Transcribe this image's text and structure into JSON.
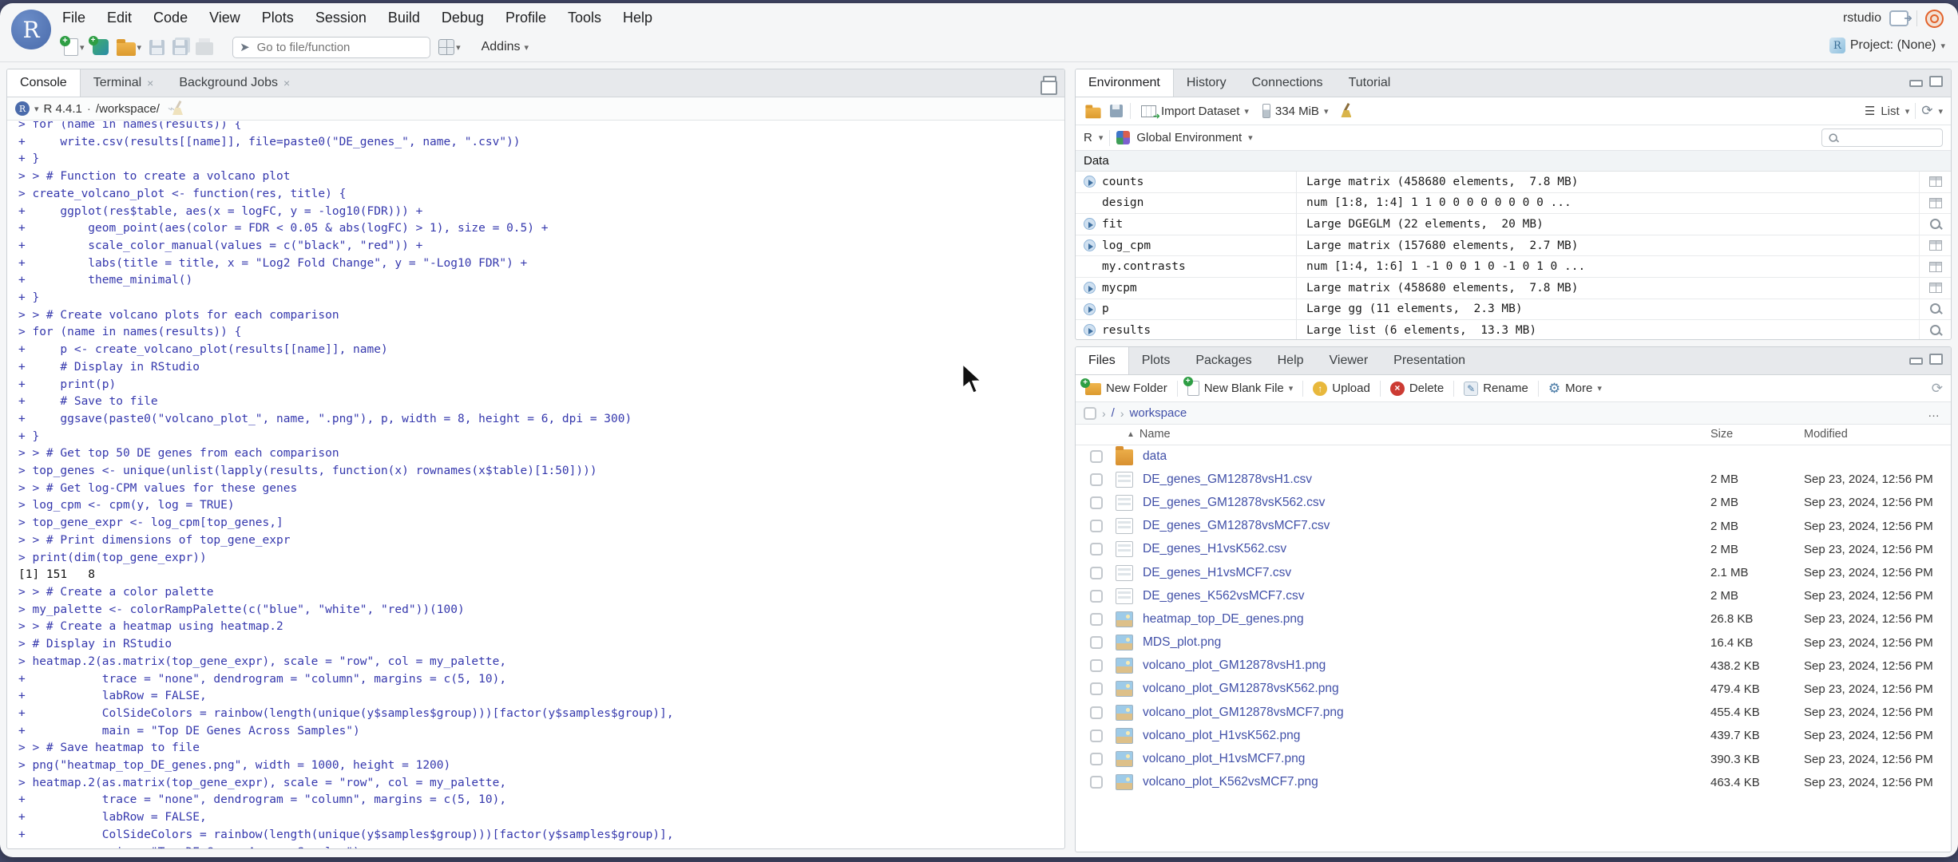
{
  "window": {
    "titlebar_user": "rstudio",
    "project_label": "Project: (None)"
  },
  "glyphs": {
    "caret_down": "▾",
    "sort_asc": "▲",
    "chevron": "›",
    "close": "×",
    "ellipsis": "…",
    "list": "☰",
    "refresh": "⟳",
    "dot_sep": "·",
    "gear": "⚙",
    "pencil": "✎",
    "up_arrow": "↑",
    "plus": "+",
    "goto_arrow": "➤"
  },
  "menu_bar": {
    "items": [
      "File",
      "Edit",
      "Code",
      "View",
      "Plots",
      "Session",
      "Build",
      "Debug",
      "Profile",
      "Tools",
      "Help"
    ]
  },
  "toolbar": {
    "goto_placeholder": "Go to file/function",
    "addins_label": "Addins"
  },
  "console_panel": {
    "tabs": [
      {
        "label": "Console",
        "active": true,
        "closable": false
      },
      {
        "label": "Terminal",
        "active": false,
        "closable": true
      },
      {
        "label": "Background Jobs",
        "active": false,
        "closable": true
      }
    ],
    "r_version": "R 4.4.1",
    "separator": "·",
    "working_directory": "/workspace/",
    "lines": [
      {
        "kind": "input",
        "text": "> for (name in names(results)) {"
      },
      {
        "kind": "input",
        "text": "+     write.csv(results[[name]], file=paste0(\"DE_genes_\", name, \".csv\"))"
      },
      {
        "kind": "input",
        "text": "+ }"
      },
      {
        "kind": "input",
        "text": "> > # Function to create a volcano plot"
      },
      {
        "kind": "input",
        "text": "> create_volcano_plot <- function(res, title) {"
      },
      {
        "kind": "input",
        "text": "+     ggplot(res$table, aes(x = logFC, y = -log10(FDR))) +"
      },
      {
        "kind": "input",
        "text": "+         geom_point(aes(color = FDR < 0.05 & abs(logFC) > 1), size = 0.5) +"
      },
      {
        "kind": "input",
        "text": "+         scale_color_manual(values = c(\"black\", \"red\")) +"
      },
      {
        "kind": "input",
        "text": "+         labs(title = title, x = \"Log2 Fold Change\", y = \"-Log10 FDR\") +"
      },
      {
        "kind": "input",
        "text": "+         theme_minimal()"
      },
      {
        "kind": "input",
        "text": "+ }"
      },
      {
        "kind": "input",
        "text": "> > # Create volcano plots for each comparison"
      },
      {
        "kind": "input",
        "text": "> for (name in names(results)) {"
      },
      {
        "kind": "input",
        "text": "+     p <- create_volcano_plot(results[[name]], name)"
      },
      {
        "kind": "input",
        "text": "+     # Display in RStudio"
      },
      {
        "kind": "input",
        "text": "+     print(p)"
      },
      {
        "kind": "input",
        "text": "+     # Save to file"
      },
      {
        "kind": "input",
        "text": "+     ggsave(paste0(\"volcano_plot_\", name, \".png\"), p, width = 8, height = 6, dpi = 300)"
      },
      {
        "kind": "input",
        "text": "+ }"
      },
      {
        "kind": "input",
        "text": "> > # Get top 50 DE genes from each comparison"
      },
      {
        "kind": "input",
        "text": "> top_genes <- unique(unlist(lapply(results, function(x) rownames(x$table)[1:50])))"
      },
      {
        "kind": "input",
        "text": "> > # Get log-CPM values for these genes"
      },
      {
        "kind": "input",
        "text": "> log_cpm <- cpm(y, log = TRUE)"
      },
      {
        "kind": "input",
        "text": "> top_gene_expr <- log_cpm[top_genes,]"
      },
      {
        "kind": "input",
        "text": "> > # Print dimensions of top_gene_expr"
      },
      {
        "kind": "input",
        "text": "> print(dim(top_gene_expr))"
      },
      {
        "kind": "output",
        "text": "[1] 151   8"
      },
      {
        "kind": "input",
        "text": "> > # Create a color palette"
      },
      {
        "kind": "input",
        "text": "> my_palette <- colorRampPalette(c(\"blue\", \"white\", \"red\"))(100)"
      },
      {
        "kind": "input",
        "text": "> > # Create a heatmap using heatmap.2"
      },
      {
        "kind": "input",
        "text": "> # Display in RStudio"
      },
      {
        "kind": "input",
        "text": "> heatmap.2(as.matrix(top_gene_expr), scale = \"row\", col = my_palette,"
      },
      {
        "kind": "input",
        "text": "+           trace = \"none\", dendrogram = \"column\", margins = c(5, 10),"
      },
      {
        "kind": "input",
        "text": "+           labRow = FALSE,"
      },
      {
        "kind": "input",
        "text": "+           ColSideColors = rainbow(length(unique(y$samples$group)))[factor(y$samples$group)],"
      },
      {
        "kind": "input",
        "text": "+           main = \"Top DE Genes Across Samples\")"
      },
      {
        "kind": "input",
        "text": "> > # Save heatmap to file"
      },
      {
        "kind": "input",
        "text": "> png(\"heatmap_top_DE_genes.png\", width = 1000, height = 1200)"
      },
      {
        "kind": "input",
        "text": "> heatmap.2(as.matrix(top_gene_expr), scale = \"row\", col = my_palette,"
      },
      {
        "kind": "input",
        "text": "+           trace = \"none\", dendrogram = \"column\", margins = c(5, 10),"
      },
      {
        "kind": "input",
        "text": "+           labRow = FALSE,"
      },
      {
        "kind": "input",
        "text": "+           ColSideColors = rainbow(length(unique(y$samples$group)))[factor(y$samples$group)],"
      },
      {
        "kind": "input",
        "text": "+           main = \"Top DE Genes Across Samples\")"
      }
    ]
  },
  "environment_panel": {
    "tabs": [
      {
        "label": "Environment",
        "active": true,
        "closable": false
      },
      {
        "label": "History",
        "active": false,
        "closable": false
      },
      {
        "label": "Connections",
        "active": false,
        "closable": false
      },
      {
        "label": "Tutorial",
        "active": false,
        "closable": false
      }
    ],
    "import_label": "Import Dataset",
    "memory_label": "334 MiB",
    "list_label": "List",
    "r_label": "R",
    "global_env_label": "Global Environment",
    "section_label": "Data",
    "rows": [
      {
        "name": "counts",
        "value": "Large matrix (458680 elements,  7.8 MB)",
        "expandable": true,
        "action": "grid"
      },
      {
        "name": "design",
        "value": "num [1:8, 1:4] 1 1 0 0 0 0 0 0 0 0 ...",
        "expandable": false,
        "action": "grid"
      },
      {
        "name": "fit",
        "value": "Large DGEGLM (22 elements,  20 MB)",
        "expandable": true,
        "action": "search"
      },
      {
        "name": "log_cpm",
        "value": "Large matrix (157680 elements,  2.7 MB)",
        "expandable": true,
        "action": "grid"
      },
      {
        "name": "my.contrasts",
        "value": "num [1:4, 1:6] 1 -1 0 0 1 0 -1 0 1 0 ...",
        "expandable": false,
        "action": "grid"
      },
      {
        "name": "mycpm",
        "value": "Large matrix (458680 elements,  7.8 MB)",
        "expandable": true,
        "action": "grid"
      },
      {
        "name": "p",
        "value": "Large gg (11 elements,  2.3 MB)",
        "expandable": true,
        "action": "search"
      },
      {
        "name": "results",
        "value": "Large list (6 elements,  13.3 MB)",
        "expandable": true,
        "action": "search"
      }
    ]
  },
  "files_panel": {
    "tabs": [
      {
        "label": "Files",
        "active": true,
        "closable": false
      },
      {
        "label": "Plots",
        "active": false,
        "closable": false
      },
      {
        "label": "Packages",
        "active": false,
        "closable": false
      },
      {
        "label": "Help",
        "active": false,
        "closable": false
      },
      {
        "label": "Viewer",
        "active": false,
        "closable": false
      },
      {
        "label": "Presentation",
        "active": false,
        "closable": false
      }
    ],
    "toolbar": [
      {
        "label": "New Folder",
        "icon": "new-folder",
        "caret": false
      },
      {
        "label": "New Blank File",
        "icon": "new-blank-file",
        "caret": true
      },
      {
        "label": "Upload",
        "icon": "upload",
        "caret": false
      },
      {
        "label": "Delete",
        "icon": "delete",
        "caret": false
      },
      {
        "label": "Rename",
        "icon": "rename",
        "caret": false
      },
      {
        "label": "More",
        "icon": "more",
        "caret": true
      }
    ],
    "breadcrumb": {
      "root": "/",
      "folder": "workspace"
    },
    "columns": [
      "Name",
      "Size",
      "Modified"
    ],
    "rows": [
      {
        "name": "data",
        "type": "folder",
        "size": "",
        "modified": ""
      },
      {
        "name": "DE_genes_GM12878vsH1.csv",
        "type": "csv",
        "size": "2 MB",
        "modified": "Sep 23, 2024, 12:56 PM"
      },
      {
        "name": "DE_genes_GM12878vsK562.csv",
        "type": "csv",
        "size": "2 MB",
        "modified": "Sep 23, 2024, 12:56 PM"
      },
      {
        "name": "DE_genes_GM12878vsMCF7.csv",
        "type": "csv",
        "size": "2 MB",
        "modified": "Sep 23, 2024, 12:56 PM"
      },
      {
        "name": "DE_genes_H1vsK562.csv",
        "type": "csv",
        "size": "2 MB",
        "modified": "Sep 23, 2024, 12:56 PM"
      },
      {
        "name": "DE_genes_H1vsMCF7.csv",
        "type": "csv",
        "size": "2.1 MB",
        "modified": "Sep 23, 2024, 12:56 PM"
      },
      {
        "name": "DE_genes_K562vsMCF7.csv",
        "type": "csv",
        "size": "2 MB",
        "modified": "Sep 23, 2024, 12:56 PM"
      },
      {
        "name": "heatmap_top_DE_genes.png",
        "type": "png",
        "size": "26.8 KB",
        "modified": "Sep 23, 2024, 12:56 PM"
      },
      {
        "name": "MDS_plot.png",
        "type": "png",
        "size": "16.4 KB",
        "modified": "Sep 23, 2024, 12:56 PM"
      },
      {
        "name": "volcano_plot_GM12878vsH1.png",
        "type": "png",
        "size": "438.2 KB",
        "modified": "Sep 23, 2024, 12:56 PM"
      },
      {
        "name": "volcano_plot_GM12878vsK562.png",
        "type": "png",
        "size": "479.4 KB",
        "modified": "Sep 23, 2024, 12:56 PM"
      },
      {
        "name": "volcano_plot_GM12878vsMCF7.png",
        "type": "png",
        "size": "455.4 KB",
        "modified": "Sep 23, 2024, 12:56 PM"
      },
      {
        "name": "volcano_plot_H1vsK562.png",
        "type": "png",
        "size": "439.7 KB",
        "modified": "Sep 23, 2024, 12:56 PM"
      },
      {
        "name": "volcano_plot_H1vsMCF7.png",
        "type": "png",
        "size": "390.3 KB",
        "modified": "Sep 23, 2024, 12:56 PM"
      },
      {
        "name": "volcano_plot_K562vsMCF7.png",
        "type": "png",
        "size": "463.4 KB",
        "modified": "Sep 23, 2024, 12:56 PM"
      }
    ]
  },
  "colors": {
    "desktop": "#434868",
    "chrome": "#f5f6f7",
    "tabbar": "#e7e9ec",
    "console_input": "#3538ad",
    "console_output": "#111111",
    "file_link": "#4150a8",
    "logo_blue": "#4a6bab",
    "quit_orange": "#e2622b"
  }
}
